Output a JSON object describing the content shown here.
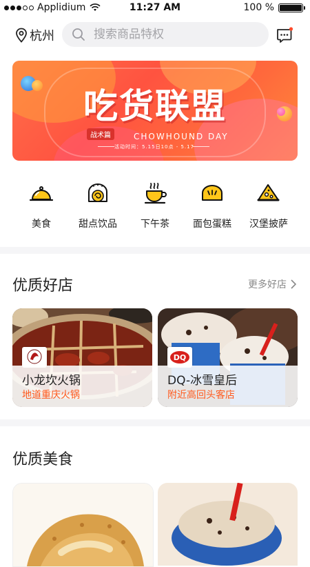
{
  "status_bar": {
    "carrier": "Applidium",
    "time": "11:27 AM",
    "battery_percent": "100 %",
    "battery_level": 1.0
  },
  "header": {
    "location": "杭州",
    "search_placeholder": "搜索商品特权"
  },
  "banner": {
    "title": "吃货联盟",
    "tag": "战术篇",
    "subtitle": "CHOWHOUND DAY",
    "date": "活动时间：5.15日10点 - 5.17"
  },
  "categories": [
    {
      "label": "美食",
      "icon": "food-cloche-icon"
    },
    {
      "label": "甜点饮品",
      "icon": "cake-roll-icon"
    },
    {
      "label": "下午茶",
      "icon": "tea-cup-icon"
    },
    {
      "label": "面包蛋糕",
      "icon": "bread-icon"
    },
    {
      "label": "汉堡披萨",
      "icon": "pizza-slice-icon"
    }
  ],
  "stores_section": {
    "title": "优质好店",
    "more": "更多好店",
    "stores": [
      {
        "name": "小龙坎火锅",
        "tagline": "地道重庆火锅",
        "logo": "小龙坎"
      },
      {
        "name": "DQ-冰雪皇后",
        "tagline": "附近高回头客店",
        "logo": "DQ"
      }
    ]
  },
  "food_section": {
    "title": "优质美食"
  },
  "colors": {
    "accent": "#ff5a1e",
    "icon_yellow": "#ffc61a",
    "divider": "#f5f5f7"
  }
}
